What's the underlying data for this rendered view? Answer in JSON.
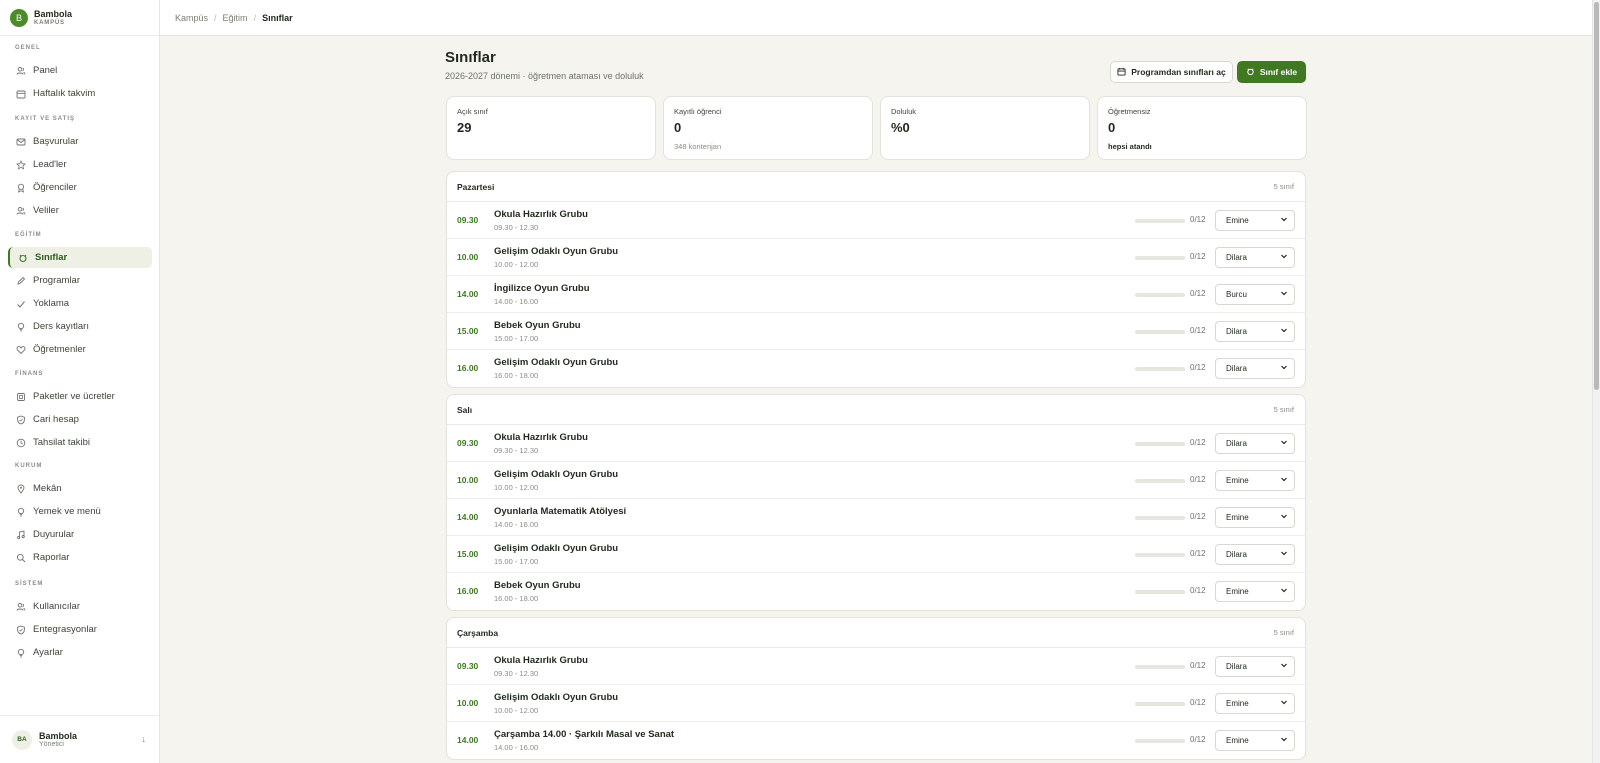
{
  "brand": {
    "logo": "B",
    "name": "Bambola",
    "sub": "KAMPÜS"
  },
  "sidebar": {
    "sections": [
      {
        "title": "GENEL",
        "items": [
          {
            "label": "Panel",
            "icon": "users-icon"
          },
          {
            "label": "Haftalık takvim",
            "icon": "calendar-icon"
          }
        ]
      },
      {
        "title": "KAYIT VE SATIŞ",
        "items": [
          {
            "label": "Başvurular",
            "icon": "mail-icon"
          },
          {
            "label": "Lead'ler",
            "icon": "star-icon"
          },
          {
            "label": "Öğrenciler",
            "icon": "award-icon"
          },
          {
            "label": "Veliler",
            "icon": "users-icon"
          }
        ]
      },
      {
        "title": "EĞİTİM",
        "items": [
          {
            "label": "Sınıflar",
            "icon": "class-icon",
            "active": true
          },
          {
            "label": "Programlar",
            "icon": "pencil-icon"
          },
          {
            "label": "Yoklama",
            "icon": "check-icon"
          },
          {
            "label": "Ders kayıtları",
            "icon": "bulb-icon"
          },
          {
            "label": "Öğretmenler",
            "icon": "heart-icon"
          }
        ]
      },
      {
        "title": "FİNANS",
        "items": [
          {
            "label": "Paketler ve ücretler",
            "icon": "package-icon"
          },
          {
            "label": "Cari hesap",
            "icon": "shield-icon"
          },
          {
            "label": "Tahsilat takibi",
            "icon": "clock-icon"
          }
        ]
      },
      {
        "title": "KURUM",
        "items": [
          {
            "label": "Mekân",
            "icon": "pin-icon"
          },
          {
            "label": "Yemek ve menü",
            "icon": "bulb-icon"
          },
          {
            "label": "Duyurular",
            "icon": "music-icon"
          },
          {
            "label": "Raporlar",
            "icon": "search-icon"
          }
        ]
      },
      {
        "title": "SİSTEM",
        "items": [
          {
            "label": "Kullanıcılar",
            "icon": "users-icon"
          },
          {
            "label": "Entegrasyonlar",
            "icon": "shield-icon"
          },
          {
            "label": "Ayarlar",
            "icon": "bulb-icon"
          }
        ]
      }
    ]
  },
  "user": {
    "initials": "BA",
    "name": "Bambola",
    "role": "Yönetici"
  },
  "breadcrumb": [
    "Kampüs",
    "Eğitim",
    "Sınıflar"
  ],
  "header": {
    "title": "Sınıflar",
    "subtitle": "2026-2027 dönemi · öğretmen ataması ve doluluk",
    "open_from_program_label": "Programdan sınıfları aç",
    "add_class_label": "Sınıf ekle"
  },
  "stats": [
    {
      "label": "Açık sınıf",
      "value": "29",
      "note": ""
    },
    {
      "label": "Kayıtlı öğrenci",
      "value": "0",
      "note": "348 kontenjan"
    },
    {
      "label": "Doluluk",
      "value": "%0",
      "note": ""
    },
    {
      "label": "Öğretmensiz",
      "value": "0",
      "note": "hepsi atandı"
    }
  ],
  "days": [
    {
      "name": "Pazartesi",
      "count": "5 sınıf",
      "classes": [
        {
          "time": "09.30",
          "title": "Okula Hazırlık Grubu",
          "range": "09.30 - 12.30",
          "cap": "0/12",
          "fill": 0,
          "teacher": "Emine"
        },
        {
          "time": "10.00",
          "title": "Gelişim Odaklı Oyun Grubu",
          "range": "10.00 - 12.00",
          "cap": "0/12",
          "fill": 0,
          "teacher": "Dilara"
        },
        {
          "time": "14.00",
          "title": "İngilizce Oyun Grubu",
          "range": "14.00 - 16.00",
          "cap": "0/12",
          "fill": 0,
          "teacher": "Burcu"
        },
        {
          "time": "15.00",
          "title": "Bebek Oyun Grubu",
          "range": "15.00 - 17.00",
          "cap": "0/12",
          "fill": 0,
          "teacher": "Dilara"
        },
        {
          "time": "16.00",
          "title": "Gelişim Odaklı Oyun Grubu",
          "range": "16.00 - 18.00",
          "cap": "0/12",
          "fill": 0,
          "teacher": "Dilara"
        }
      ]
    },
    {
      "name": "Salı",
      "count": "5 sınıf",
      "classes": [
        {
          "time": "09.30",
          "title": "Okula Hazırlık Grubu",
          "range": "09.30 - 12.30",
          "cap": "0/12",
          "fill": 0,
          "teacher": "Dilara"
        },
        {
          "time": "10.00",
          "title": "Gelişim Odaklı Oyun Grubu",
          "range": "10.00 - 12.00",
          "cap": "0/12",
          "fill": 0,
          "teacher": "Emine"
        },
        {
          "time": "14.00",
          "title": "Oyunlarla Matematik Atölyesi",
          "range": "14.00 - 16.00",
          "cap": "0/12",
          "fill": 0,
          "teacher": "Emine"
        },
        {
          "time": "15.00",
          "title": "Gelişim Odaklı Oyun Grubu",
          "range": "15.00 - 17.00",
          "cap": "0/12",
          "fill": 0,
          "teacher": "Dilara"
        },
        {
          "time": "16.00",
          "title": "Bebek Oyun Grubu",
          "range": "16.00 - 18.00",
          "cap": "0/12",
          "fill": 0,
          "teacher": "Emine"
        }
      ]
    },
    {
      "name": "Çarşamba",
      "count": "5 sınıf",
      "classes": [
        {
          "time": "09.30",
          "title": "Okula Hazırlık Grubu",
          "range": "09.30 - 12.30",
          "cap": "0/12",
          "fill": 0,
          "teacher": "Dilara"
        },
        {
          "time": "10.00",
          "title": "Gelişim Odaklı Oyun Grubu",
          "range": "10.00 - 12.00",
          "cap": "0/12",
          "fill": 0,
          "teacher": "Emine"
        },
        {
          "time": "14.00",
          "title": "Çarşamba 14.00 · Şarkılı Masal ve Sanat",
          "range": "14.00 - 16.00",
          "cap": "0/12",
          "fill": 0,
          "teacher": "Emine"
        }
      ]
    }
  ],
  "colors": {
    "accent": "#3f7a22",
    "background": "#f5f4ef",
    "card": "#ffffff"
  }
}
